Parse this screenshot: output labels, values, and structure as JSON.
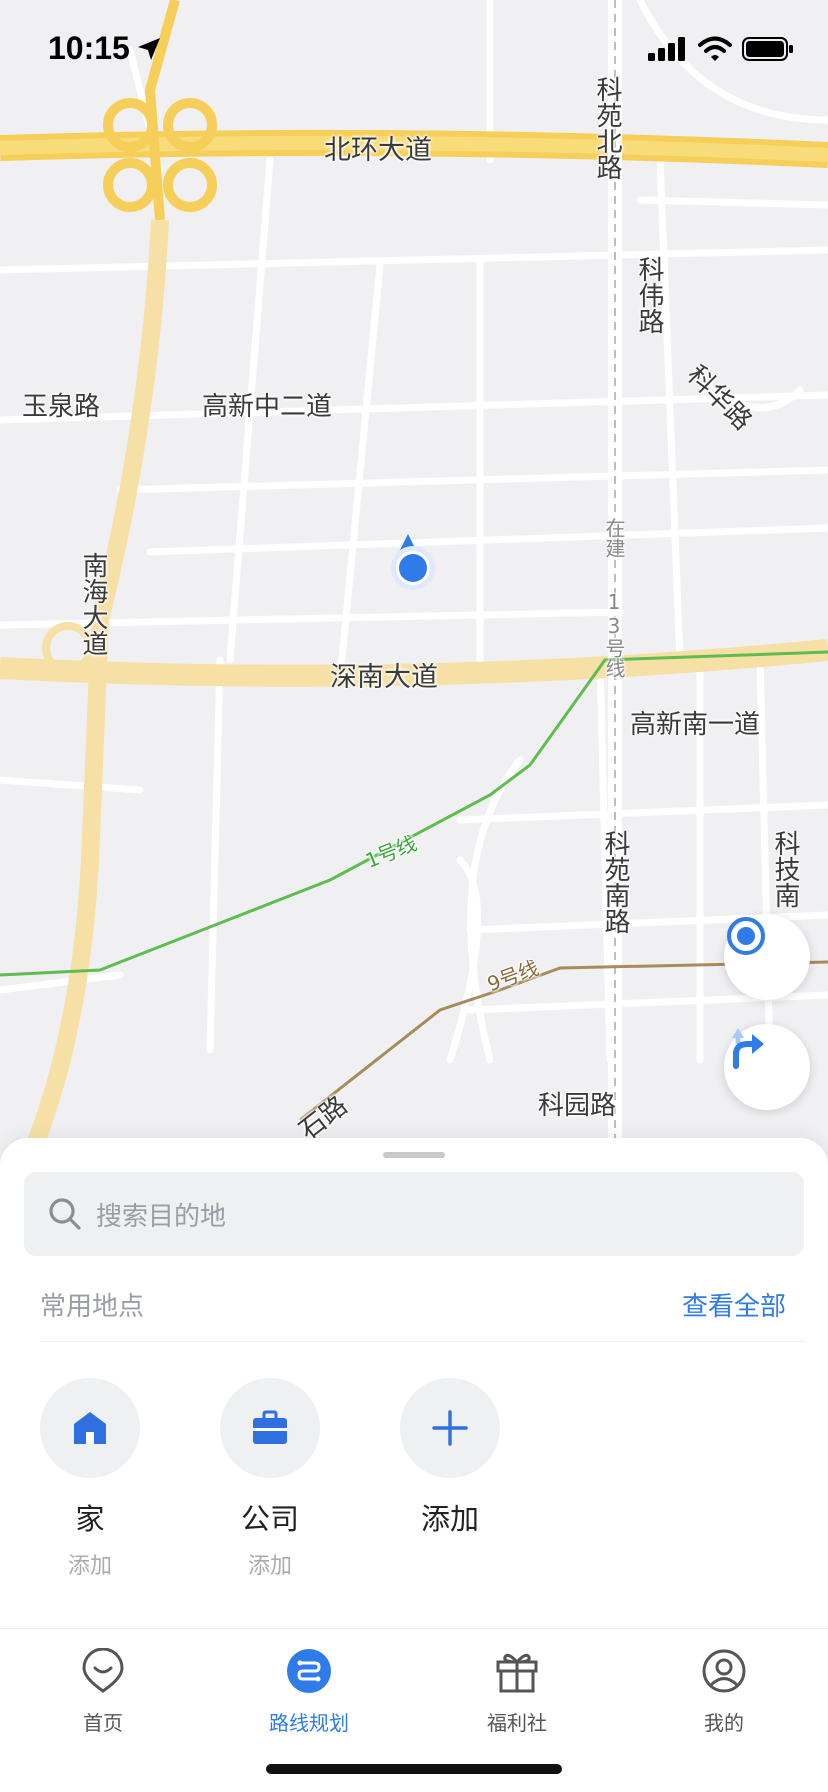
{
  "status_bar": {
    "time": "10:15"
  },
  "map": {
    "roads": {
      "north_ring": "北环大道",
      "keyuan_north": "科苑北路",
      "kewei": "科伟路",
      "kehua": "科华路",
      "yuquan": "玉泉路",
      "gaoxin_zhong2": "高新中二道",
      "nanhai": "南海大道",
      "shennan": "深南大道",
      "gaoxin_nan1": "高新南一道",
      "keyuan_south": "科苑南路",
      "keji_south": "科技南",
      "keyuan": "科园路",
      "shi_road": "石路"
    },
    "metro": {
      "line1": "1号线",
      "line9": "9号线",
      "line13": "13号线",
      "under_construction": "在建"
    },
    "colors": {
      "line1": "#5ebd4e",
      "line9": "#a98a5c",
      "location": "#2f7be8",
      "highway": "#f5cf5a"
    }
  },
  "search": {
    "placeholder": "搜索目的地"
  },
  "frequent": {
    "title": "常用地点",
    "view_all": "查看全部",
    "places": [
      {
        "name": "家",
        "sub": "添加",
        "icon": "home-icon"
      },
      {
        "name": "公司",
        "sub": "添加",
        "icon": "briefcase-icon"
      },
      {
        "name": "添加",
        "sub": "",
        "icon": "plus-icon"
      }
    ]
  },
  "tabs": [
    {
      "label": "首页",
      "icon": "home-smile-icon",
      "active": false
    },
    {
      "label": "路线规划",
      "icon": "route-icon",
      "active": true
    },
    {
      "label": "福利社",
      "icon": "gift-icon",
      "active": false
    },
    {
      "label": "我的",
      "icon": "user-icon",
      "active": false
    }
  ]
}
